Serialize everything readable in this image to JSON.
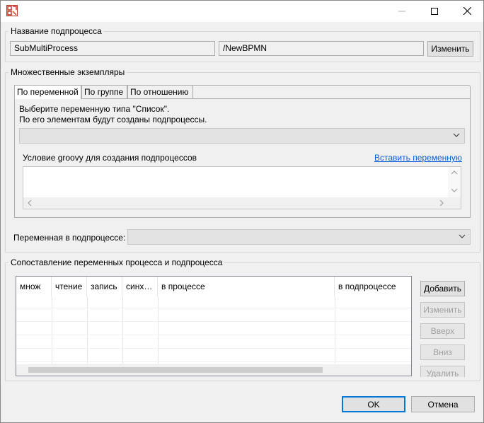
{
  "window": {
    "icon": "app-logo-icon",
    "controls": [
      "minimize-icon",
      "maximize-icon",
      "close-icon"
    ]
  },
  "subprocess_name": {
    "title": "Название подпроцесса",
    "name_value": "SubMultiProcess",
    "path_value": "/NewBPMN",
    "change_label": "Изменить"
  },
  "multiple_instances": {
    "title": "Множественные экземпляры",
    "tabs": [
      "По переменной",
      "По группе",
      "По отношению"
    ],
    "active_tab": 0,
    "instruction_line1": "Выберите переменную типа \"Список\".",
    "instruction_line2": "По его элементам будут созданы подпроцессы.",
    "list_variable_value": "",
    "groovy_label": "Условие groovy для создания подпроцессов",
    "insert_variable_link": "Вставить переменную",
    "groovy_value": ""
  },
  "subprocess_variable": {
    "label": "Переменная в подпроцессе:",
    "value": ""
  },
  "mapping": {
    "title": "Сопоставление переменных процесса и подпроцесса",
    "columns": [
      "множ",
      "чтение",
      "запись",
      "синх…",
      "в процессе",
      "в подпроцессе"
    ],
    "rows": [],
    "buttons": {
      "add": "Добавить",
      "edit": "Изменить",
      "up": "Вверх",
      "down": "Вниз",
      "delete": "Удалить"
    }
  },
  "footer": {
    "ok": "OK",
    "cancel": "Отмена"
  },
  "colors": {
    "accent": "#0078d7",
    "link": "#0b5ed7",
    "background": "#f0f0f0"
  }
}
